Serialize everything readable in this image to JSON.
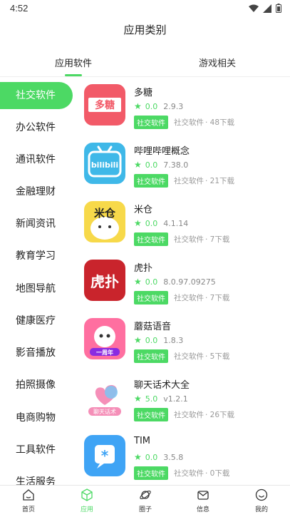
{
  "status_bar": {
    "time": "4:52"
  },
  "header": {
    "title": "应用类别"
  },
  "tabs": [
    {
      "label": "应用软件",
      "active": true
    },
    {
      "label": "游戏相关",
      "active": false
    }
  ],
  "categories": [
    {
      "label": "社交软件",
      "active": true
    },
    {
      "label": "办公软件"
    },
    {
      "label": "通讯软件"
    },
    {
      "label": "金融理财"
    },
    {
      "label": "新闻资讯"
    },
    {
      "label": "教育学习"
    },
    {
      "label": "地图导航"
    },
    {
      "label": "健康医疗"
    },
    {
      "label": "影音播放"
    },
    {
      "label": "拍照摄像"
    },
    {
      "label": "电商购物"
    },
    {
      "label": "工具软件"
    },
    {
      "label": "生活服务"
    }
  ],
  "apps": [
    {
      "name": "多糖",
      "score": "0.0",
      "version": "2.9.3",
      "badge": "社交软件",
      "category": "社交软件",
      "downloads": "· 48下载",
      "icon": "duotang-icon",
      "icon_text": "多糖"
    },
    {
      "name": "哔哩哔哩概念",
      "score": "0.0",
      "version": "7.38.0",
      "badge": "社交软件",
      "category": "社交软件",
      "downloads": "· 21下载",
      "icon": "bilibili-icon",
      "icon_text": "bilibili"
    },
    {
      "name": "米仓",
      "score": "0.0",
      "version": "4.1.14",
      "badge": "社交软件",
      "category": "社交软件",
      "downloads": "· 7下载",
      "icon": "micang-icon",
      "icon_text": "米仓"
    },
    {
      "name": "虎扑",
      "score": "0.0",
      "version": "8.0.97.09275",
      "badge": "社交软件",
      "category": "社交软件",
      "downloads": "· 7下载",
      "icon": "hupu-icon",
      "icon_text": "虎扑"
    },
    {
      "name": "蘑菇语音",
      "score": "0.0",
      "version": "1.8.3",
      "badge": "社交软件",
      "category": "社交软件",
      "downloads": "· 5下载",
      "icon": "mogu-icon",
      "icon_text": "一周年"
    },
    {
      "name": "聊天话术大全",
      "score": "5.0",
      "version": "v1.2.1",
      "badge": "社交软件",
      "category": "社交软件",
      "downloads": "· 26下载",
      "icon": "chat-tips-icon",
      "icon_text": "聊天话术"
    },
    {
      "name": "TIM",
      "score": "0.0",
      "version": "3.5.8",
      "badge": "社交软件",
      "category": "社交软件",
      "downloads": "· 0下载",
      "icon": "tim-icon",
      "icon_text": ""
    }
  ],
  "bottom_nav": [
    {
      "label": "首页",
      "icon": "home-icon",
      "active": false
    },
    {
      "label": "应用",
      "icon": "cube-icon",
      "active": true
    },
    {
      "label": "圈子",
      "icon": "planet-icon",
      "active": false
    },
    {
      "label": "信息",
      "icon": "mail-icon",
      "active": false
    },
    {
      "label": "我的",
      "icon": "smile-icon",
      "active": false
    }
  ],
  "colors": {
    "accent": "#4cd964",
    "text": "#222222",
    "muted": "#999999"
  }
}
